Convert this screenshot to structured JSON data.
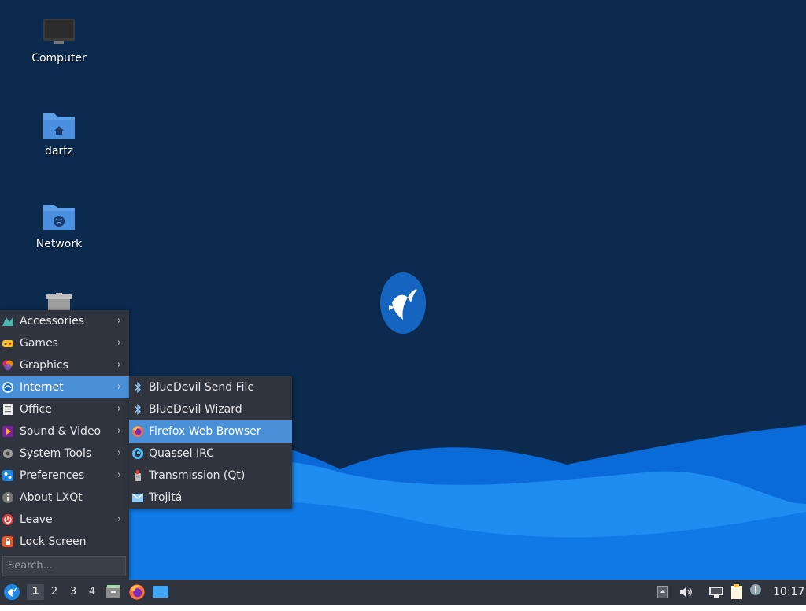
{
  "desktop": {
    "icons": [
      {
        "label": "Computer",
        "icon": "computer-icon"
      },
      {
        "label": "dartz",
        "icon": "home-folder-icon"
      },
      {
        "label": "Network",
        "icon": "network-folder-icon"
      },
      {
        "label": "",
        "icon": "trash-icon"
      }
    ],
    "logo": "lubuntu-logo"
  },
  "main_menu": {
    "items": [
      {
        "label": "Accessories",
        "icon": "accessories-icon",
        "submenu": true
      },
      {
        "label": "Games",
        "icon": "games-icon",
        "submenu": true
      },
      {
        "label": "Graphics",
        "icon": "graphics-icon",
        "submenu": true
      },
      {
        "label": "Internet",
        "icon": "internet-icon",
        "submenu": true,
        "active": true
      },
      {
        "label": "Office",
        "icon": "office-icon",
        "submenu": true
      },
      {
        "label": "Sound & Video",
        "icon": "sound-video-icon",
        "submenu": true
      },
      {
        "label": "System Tools",
        "icon": "system-tools-icon",
        "submenu": true
      },
      {
        "label": "Preferences",
        "icon": "preferences-icon",
        "submenu": true
      },
      {
        "label": "About LXQt",
        "icon": "info-icon",
        "submenu": false
      },
      {
        "label": "Leave",
        "icon": "power-icon",
        "submenu": true
      },
      {
        "label": "Lock Screen",
        "icon": "lock-icon",
        "submenu": false
      }
    ],
    "search_placeholder": "Search..."
  },
  "submenu_internet": {
    "items": [
      {
        "label": "BlueDevil Send File",
        "icon": "bluetooth-icon"
      },
      {
        "label": "BlueDevil Wizard",
        "icon": "bluetooth-icon"
      },
      {
        "label": "Firefox Web Browser",
        "icon": "firefox-icon",
        "active": true
      },
      {
        "label": "Quassel IRC",
        "icon": "quassel-icon"
      },
      {
        "label": "Transmission (Qt)",
        "icon": "transmission-icon"
      },
      {
        "label": "Trojitá",
        "icon": "mail-icon"
      }
    ]
  },
  "taskbar": {
    "workspaces": [
      "1",
      "2",
      "3",
      "4"
    ],
    "active_workspace": "1",
    "quicklaunch": [
      "file-manager-icon",
      "firefox-icon",
      "desktop-icon"
    ],
    "tray": [
      "show-hidden-icon",
      "volume-icon",
      "network-icon",
      "clipboard-icon",
      "update-notifier-icon"
    ],
    "clock": "10:17"
  },
  "colors": {
    "desktop_bg": "#0b2a4e",
    "menu_bg": "#2f343f",
    "highlight": "#4a90d9",
    "wave_light": "#1e90ff",
    "wave_dark": "#0a5ec8"
  }
}
